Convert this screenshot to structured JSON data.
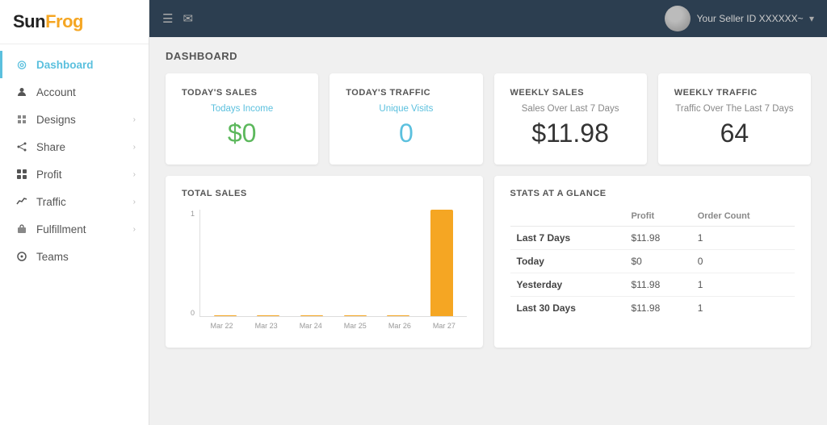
{
  "brand": {
    "name_part1": "Sun",
    "name_part2": "Frog"
  },
  "topbar": {
    "menu_icon": "☰",
    "mail_icon": "✉",
    "seller_label": "Your Seller ID",
    "seller_id": "XXXXXX~"
  },
  "sidebar": {
    "items": [
      {
        "id": "dashboard",
        "label": "Dashboard",
        "icon": "◎",
        "active": true,
        "has_chevron": false
      },
      {
        "id": "account",
        "label": "Account",
        "icon": "👤",
        "active": false,
        "has_chevron": false
      },
      {
        "id": "designs",
        "label": "Designs",
        "icon": "🎨",
        "active": false,
        "has_chevron": true
      },
      {
        "id": "share",
        "label": "Share",
        "icon": "⎇",
        "active": false,
        "has_chevron": true
      },
      {
        "id": "profit",
        "label": "Profit",
        "icon": "⊞",
        "active": false,
        "has_chevron": true
      },
      {
        "id": "traffic",
        "label": "Traffic",
        "icon": "📈",
        "active": false,
        "has_chevron": true
      },
      {
        "id": "fulfillment",
        "label": "Fulfillment",
        "icon": "📦",
        "active": false,
        "has_chevron": true
      },
      {
        "id": "teams",
        "label": "Teams",
        "icon": "⊙",
        "active": false,
        "has_chevron": false
      }
    ]
  },
  "page": {
    "title": "DASHBOARD"
  },
  "stat_cards": [
    {
      "id": "todays-sales",
      "title": "TODAY'S SALES",
      "subtitle": "Todays Income",
      "value": "$0",
      "value_color": "green",
      "subtitle_color": "blue"
    },
    {
      "id": "todays-traffic",
      "title": "TODAY'S TRAFFIC",
      "subtitle": "Unique Visits",
      "value": "0",
      "value_color": "blue",
      "subtitle_color": "blue"
    },
    {
      "id": "weekly-sales",
      "title": "WEEKLY SALES",
      "subtitle": "Sales Over Last 7 Days",
      "value": "$11.98",
      "value_color": "dark",
      "subtitle_color": "dark"
    },
    {
      "id": "weekly-traffic",
      "title": "WEEKLY TRAFFIC",
      "subtitle": "Traffic Over The Last 7 Days",
      "value": "64",
      "value_color": "dark",
      "subtitle_color": "dark"
    }
  ],
  "chart": {
    "title": "TOTAL SALES",
    "y_max": "1",
    "y_min": "0",
    "bars": [
      {
        "label": "Mar 22",
        "height_pct": 1
      },
      {
        "label": "Mar 23",
        "height_pct": 1
      },
      {
        "label": "Mar 24",
        "height_pct": 1
      },
      {
        "label": "Mar 25",
        "height_pct": 1
      },
      {
        "label": "Mar 26",
        "height_pct": 1
      },
      {
        "label": "Mar 27",
        "height_pct": 90
      }
    ]
  },
  "glance": {
    "title": "STATS AT A GLANCE",
    "columns": [
      "",
      "Profit",
      "Order Count"
    ],
    "rows": [
      {
        "label": "Last 7 Days",
        "profit": "$11.98",
        "order_count": "1"
      },
      {
        "label": "Today",
        "profit": "$0",
        "order_count": "0"
      },
      {
        "label": "Yesterday",
        "profit": "$11.98",
        "order_count": "1"
      },
      {
        "label": "Last 30 Days",
        "profit": "$11.98",
        "order_count": "1"
      }
    ]
  }
}
